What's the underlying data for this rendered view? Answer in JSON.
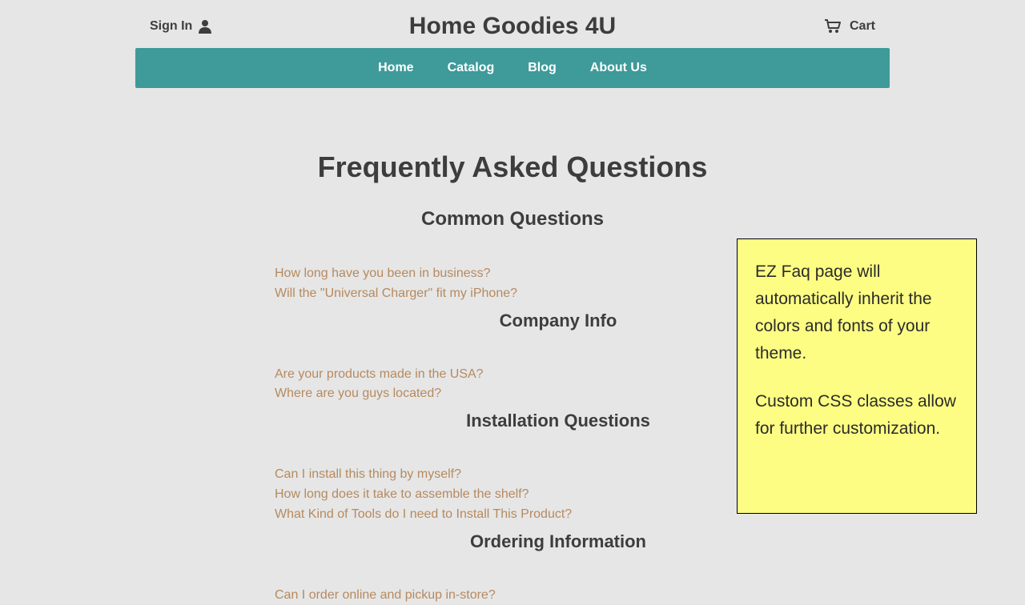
{
  "header": {
    "signin_label": "Sign In",
    "brand": "Home Goodies 4U",
    "cart_label": "Cart"
  },
  "nav": {
    "items": [
      {
        "label": "Home"
      },
      {
        "label": "Catalog"
      },
      {
        "label": "Blog"
      },
      {
        "label": "About Us"
      }
    ]
  },
  "page": {
    "title": "Frequently Asked Questions",
    "sections": [
      {
        "heading": "Common Questions",
        "items": [
          "How long have you been in business?",
          "Will the \"Universal Charger\" fit my iPhone?"
        ]
      },
      {
        "heading": "Company Info",
        "items": [
          "Are your products made in the USA?",
          "Where are you guys located?"
        ]
      },
      {
        "heading": "Installation Questions",
        "items": [
          "Can I install this thing by myself?",
          "How long does it take to assemble the shelf?",
          "What Kind of Tools do I need to Install This Product?"
        ]
      },
      {
        "heading": "Ordering Information",
        "items": [
          "Can I order online and pickup in-store?"
        ]
      }
    ]
  },
  "note": {
    "p1": "EZ Faq page will automatically inherit the colors and fonts of your theme.",
    "p2": "Custom CSS classes allow for further customization."
  },
  "colors": {
    "navbar_bg": "#3f9a9a",
    "link": "#b68a5f",
    "note_bg": "#fdfd83"
  }
}
